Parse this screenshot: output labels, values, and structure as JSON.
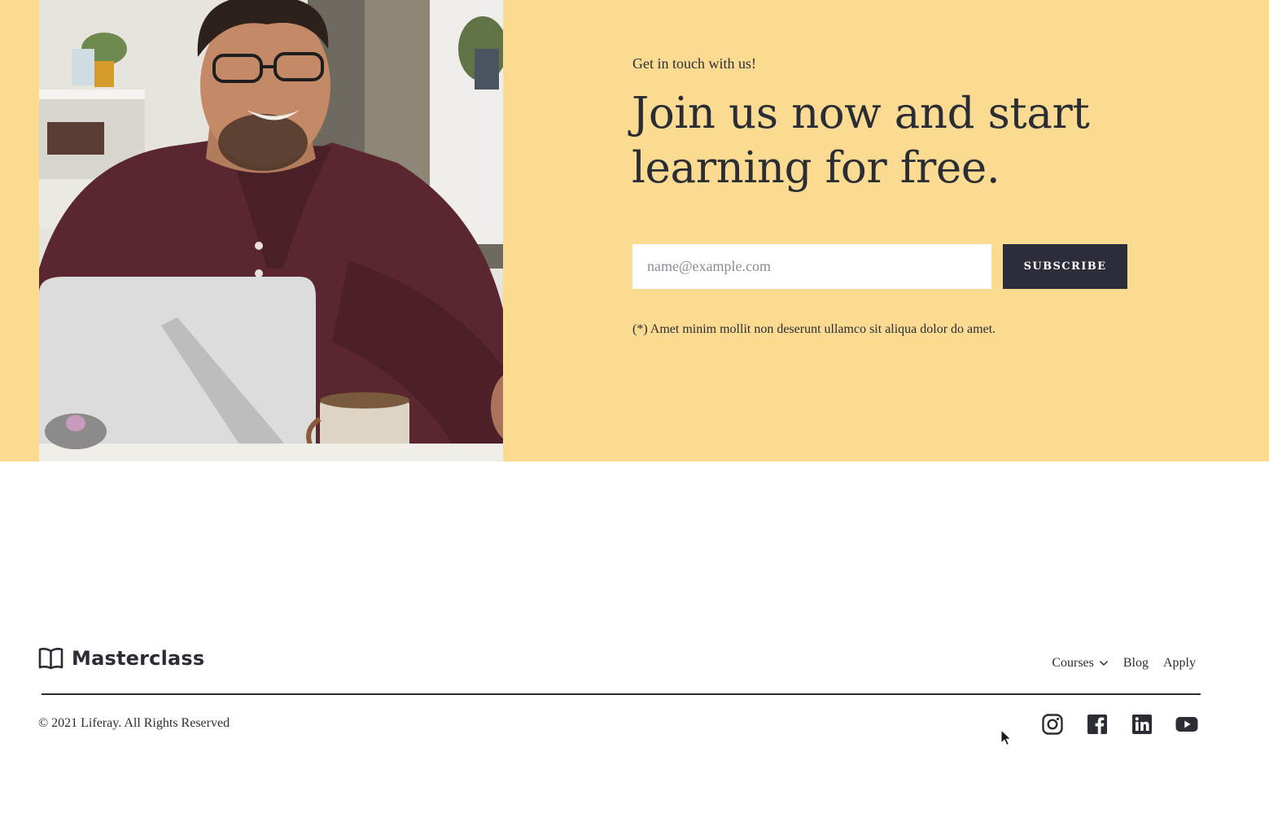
{
  "hero": {
    "eyebrow": "Get in touch with us!",
    "headline": "Join us now and start learning for free.",
    "email_placeholder": "name@example.com",
    "subscribe_label": "SUBSCRIBE",
    "disclaimer": "(*) Amet minim mollit non deserunt ullamco sit aliqua dolor do amet.",
    "background_color": "#fbdb92",
    "button_color": "#2b2d3b"
  },
  "footer": {
    "brand_name": "Masterclass",
    "brand_icon": "open-book-icon",
    "nav": [
      {
        "label": "Courses",
        "has_dropdown": true
      },
      {
        "label": "Blog"
      },
      {
        "label": "Apply"
      }
    ],
    "copyright": "© 2021 Liferay. All Rights Reserved",
    "socials": [
      "instagram-icon",
      "facebook-icon",
      "linkedin-icon",
      "youtube-icon"
    ]
  }
}
